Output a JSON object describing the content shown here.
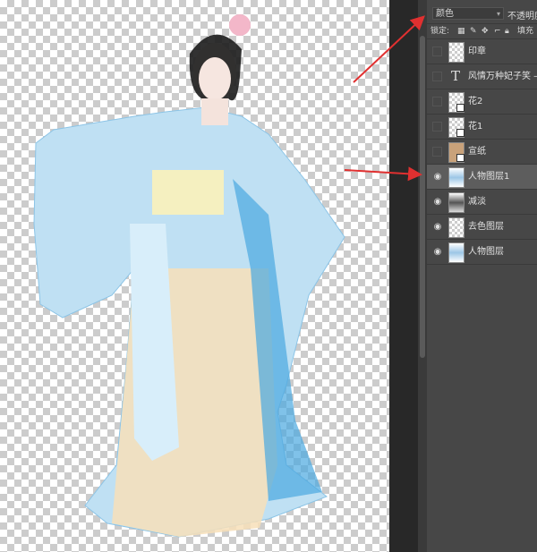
{
  "layers_panel": {
    "blend_mode": "颜色",
    "opacity_label": "不透明度",
    "lock_label": "锁定:",
    "fill_label": "填充",
    "layers": [
      {
        "name": "印章",
        "visible": false,
        "thumb": "transparent",
        "smart": false
      },
      {
        "name": "风情万种妃子笑 —",
        "visible": false,
        "thumb": "text",
        "smart": false
      },
      {
        "name": "花2",
        "visible": false,
        "thumb": "transparent",
        "smart": true
      },
      {
        "name": "花1",
        "visible": false,
        "thumb": "transparent",
        "smart": true
      },
      {
        "name": "宣纸",
        "visible": false,
        "thumb": "paper",
        "smart": true
      },
      {
        "name": "人物图层1",
        "visible": true,
        "thumb": "person",
        "selected": true
      },
      {
        "name": "减淡",
        "visible": true,
        "thumb": "dark"
      },
      {
        "name": "去色图层",
        "visible": true,
        "thumb": "transparent"
      },
      {
        "name": "人物图层",
        "visible": true,
        "thumb": "person"
      }
    ]
  },
  "icons": {
    "eye": "eye-icon",
    "text_layer": "T",
    "chevron": "▾"
  },
  "colors": {
    "arrow": "#e03030",
    "selected_row": "#5d5d5d",
    "panel": "#474747"
  }
}
